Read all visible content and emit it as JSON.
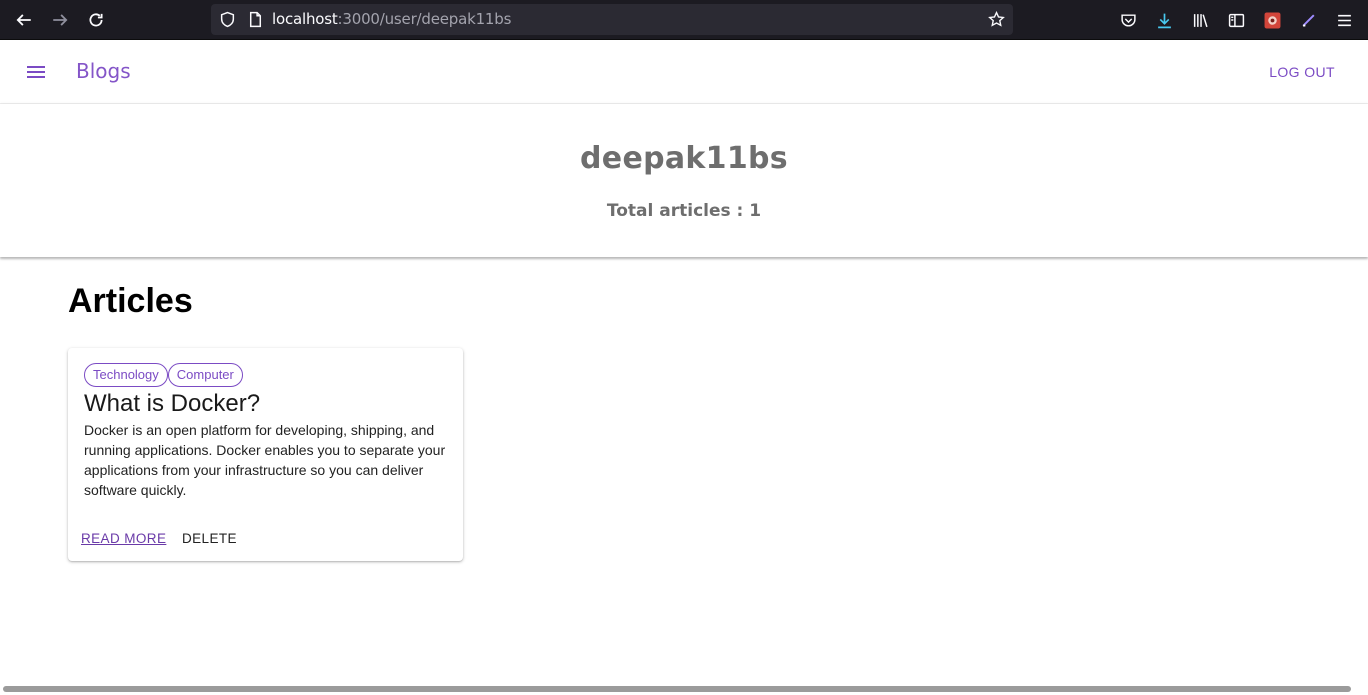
{
  "browser": {
    "url_host": "localhost",
    "url_path": ":3000/user/deepak11bs"
  },
  "app_bar": {
    "brand": "Blogs",
    "logout_label": "LOG OUT"
  },
  "profile": {
    "username": "deepak11bs",
    "total_articles": "Total articles : 1"
  },
  "articles_section": {
    "title": "Articles",
    "items": [
      {
        "tags": [
          "Technology",
          "Computer"
        ],
        "title": "What is Docker?",
        "excerpt": "Docker is an open platform for developing, shipping, and running applications. Docker enables you to separate your applications from your infrastructure so you can deliver software quickly.",
        "read_more_label": "READ MORE",
        "delete_label": "DELETE"
      }
    ]
  },
  "colors": {
    "accent": "#7b4bc4",
    "browser_bg": "#1c1b22",
    "muted_text": "#6e6e6e"
  }
}
